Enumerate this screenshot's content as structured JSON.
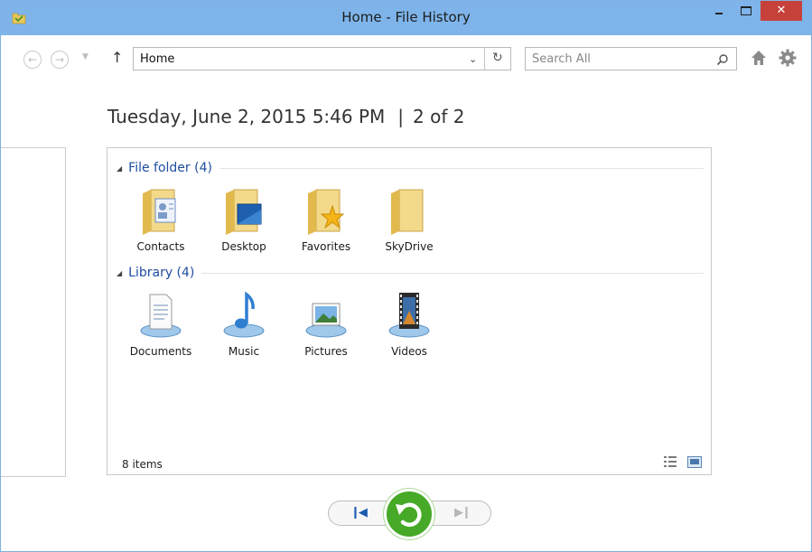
{
  "window": {
    "title": "Home - File History",
    "close_label": "✕"
  },
  "nav": {
    "back_icon": "arrow-left-icon",
    "forward_icon": "arrow-right-icon",
    "up_label": "↑",
    "address": "Home",
    "search_placeholder": "Search All"
  },
  "datebar": {
    "date": "Tuesday, June 2, 2015 5:46 PM",
    "separator": "|",
    "position": "2 of 2"
  },
  "groups": [
    {
      "header": "File folder (4)",
      "items": [
        {
          "label": "Contacts",
          "icon": "contacts-folder-icon"
        },
        {
          "label": "Desktop",
          "icon": "desktop-folder-icon"
        },
        {
          "label": "Favorites",
          "icon": "favorites-folder-icon"
        },
        {
          "label": "SkyDrive",
          "icon": "skydrive-folder-icon"
        }
      ]
    },
    {
      "header": "Library (4)",
      "items": [
        {
          "label": "Documents",
          "icon": "documents-library-icon"
        },
        {
          "label": "Music",
          "icon": "music-library-icon"
        },
        {
          "label": "Pictures",
          "icon": "pictures-library-icon"
        },
        {
          "label": "Videos",
          "icon": "videos-library-icon"
        }
      ]
    }
  ],
  "status": {
    "count": "8 items"
  },
  "colors": {
    "titlebar": "#7eb4ea",
    "close": "#c7413b",
    "restore": "#47a928",
    "group_header": "#1f4ea0"
  }
}
